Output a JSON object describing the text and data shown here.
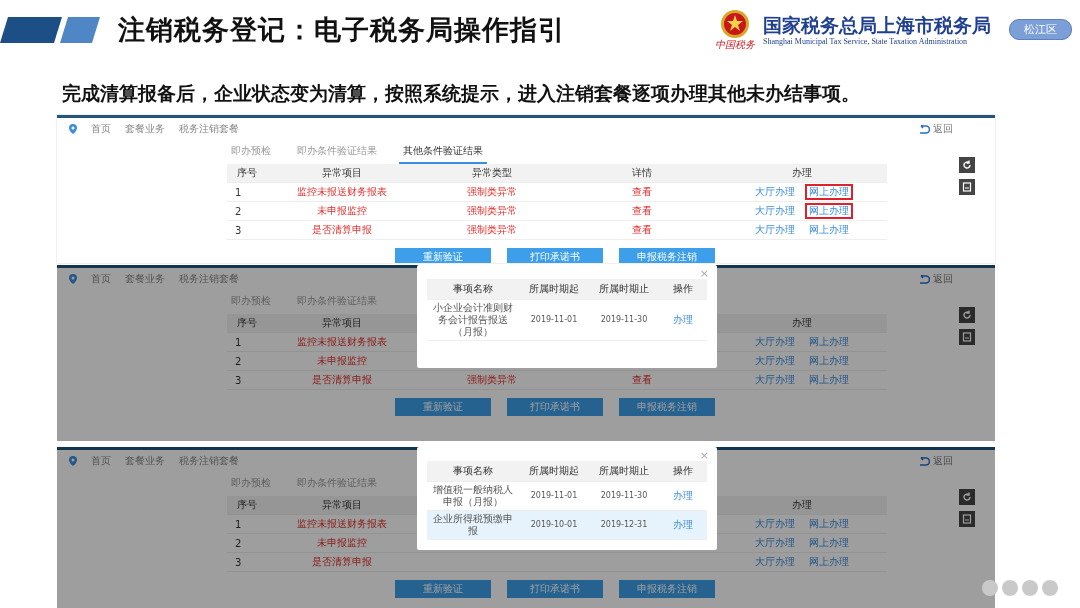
{
  "header": {
    "title": "注销税务登记：电子税务局操作指引",
    "seal_text": "中国税务",
    "agency": "国家税务总局上海市税务局",
    "agency_en": "Shanghai Municipal Tax Service, State Taxation Administration",
    "district": "松江区"
  },
  "intro": "完成清算报备后，企业状态变为清算，按照系统提示，进入注销套餐逐项办理其他未办结事项。",
  "screenshots": [
    {
      "breadcrumb": [
        "首页",
        "套餐业务",
        "税务注销套餐"
      ],
      "back": "返回",
      "dimmed": false,
      "tabs": [
        {
          "label": "即办预检",
          "selected": false
        },
        {
          "label": "即办条件验证结果",
          "selected": false
        },
        {
          "label": "其他条件验证结果",
          "selected": true
        }
      ],
      "table": {
        "header": {
          "no": "序号",
          "item": "异常项目",
          "type": "异常类型",
          "detail": "详情",
          "action": "办理"
        },
        "rows": [
          {
            "no": "1",
            "item": "监控未报送财务报表",
            "type": "强制类异常",
            "detail": "查看",
            "actions": [
              {
                "label": "大厅办理",
                "annotated": false
              },
              {
                "label": "网上办理",
                "annotated": true
              }
            ]
          },
          {
            "no": "2",
            "item": "未申报监控",
            "type": "强制类异常",
            "detail": "查看",
            "actions": [
              {
                "label": "大厅办理",
                "annotated": false
              },
              {
                "label": "网上办理",
                "annotated": true
              }
            ]
          },
          {
            "no": "3",
            "item": "是否清算申报",
            "type": "强制类异常",
            "detail": "查看",
            "actions": [
              {
                "label": "大厅办理",
                "annotated": false
              },
              {
                "label": "网上办理",
                "annotated": false
              }
            ]
          }
        ]
      },
      "buttons": [
        "重新验证",
        "打印承诺书",
        "申报税务注销"
      ]
    },
    {
      "breadcrumb": [
        "首页",
        "套餐业务",
        "税务注销套餐"
      ],
      "back": "返回",
      "dimmed": true,
      "tabs": [
        {
          "label": "即办预检",
          "selected": false
        },
        {
          "label": "即办条件验证结果",
          "selected": false
        }
      ],
      "table": {
        "header": {
          "no": "序号",
          "item": "异常项目",
          "action": "办理"
        },
        "rows": [
          {
            "no": "1",
            "item": "监控未报送财务报表",
            "actions": [
              {
                "label": "大厅办理",
                "annotated": false
              },
              {
                "label": "网上办理",
                "annotated": false
              }
            ]
          },
          {
            "no": "2",
            "item": "未申报监控",
            "actions": [
              {
                "label": "大厅办理",
                "annotated": false
              },
              {
                "label": "网上办理",
                "annotated": false
              }
            ]
          },
          {
            "no": "3",
            "item": "是否清算申报",
            "type": "强制类异常",
            "detail": "查看",
            "actions": [
              {
                "label": "大厅办理",
                "annotated": false
              },
              {
                "label": "网上办理",
                "annotated": false
              }
            ]
          }
        ]
      },
      "buttons": [
        "重新验证",
        "打印承诺书",
        "申报税务注销"
      ],
      "dialog": {
        "close": "×",
        "columns": [
          "事项名称",
          "所属时期起",
          "所属时期止",
          "操作"
        ],
        "rows": [
          {
            "name": "小企业会计准则财务会计报告报送（月报）",
            "start": "2019-11-01",
            "end": "2019-11-30",
            "action": "办理",
            "selected": false
          }
        ]
      }
    },
    {
      "breadcrumb": [
        "首页",
        "套餐业务",
        "税务注销套餐"
      ],
      "back": "返回",
      "dimmed": true,
      "tabs": [
        {
          "label": "即办预检",
          "selected": false
        },
        {
          "label": "即办条件验证结果",
          "selected": false
        }
      ],
      "table": {
        "header": {
          "no": "序号",
          "item": "异常项目",
          "action": "办理"
        },
        "rows": [
          {
            "no": "1",
            "item": "监控未报送财务报表",
            "actions": [
              {
                "label": "大厅办理",
                "annotated": false
              },
              {
                "label": "网上办理",
                "annotated": false
              }
            ]
          },
          {
            "no": "2",
            "item": "未申报监控",
            "actions": [
              {
                "label": "大厅办理",
                "annotated": false
              },
              {
                "label": "网上办理",
                "annotated": false
              }
            ]
          },
          {
            "no": "3",
            "item": "是否清算申报",
            "actions": [
              {
                "label": "大厅办理",
                "annotated": false
              },
              {
                "label": "网上办理",
                "annotated": false
              }
            ]
          }
        ]
      },
      "buttons": [
        "重新验证",
        "打印承诺书",
        "申报税务注销"
      ],
      "dialog": {
        "close": "×",
        "columns": [
          "事项名称",
          "所属时期起",
          "所属时期止",
          "操作"
        ],
        "rows": [
          {
            "name": "增值税一般纳税人申报（月报）",
            "start": "2019-11-01",
            "end": "2019-11-30",
            "action": "办理",
            "selected": false
          },
          {
            "name": "企业所得税预缴申报",
            "start": "2019-10-01",
            "end": "2019-12-31",
            "action": "办理",
            "selected": true
          }
        ]
      }
    }
  ]
}
